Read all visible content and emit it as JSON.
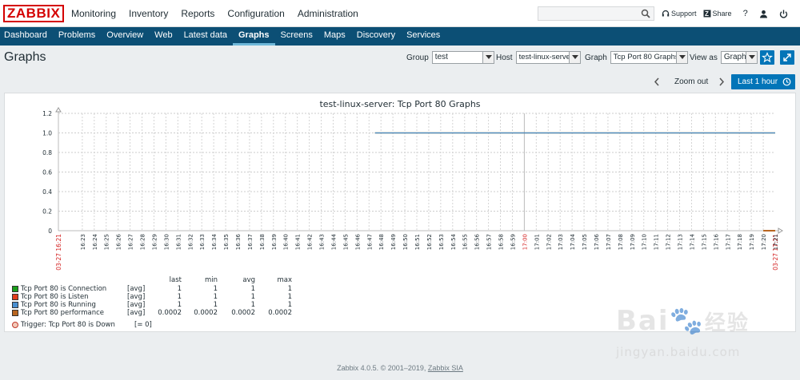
{
  "header": {
    "logo": "ZABBIX",
    "menu": [
      "Monitoring",
      "Inventory",
      "Reports",
      "Configuration",
      "Administration"
    ],
    "search_placeholder": "",
    "support_label": "Support",
    "share_label": "Share",
    "help_label": "?"
  },
  "submenu": [
    "Dashboard",
    "Problems",
    "Overview",
    "Web",
    "Latest data",
    "Graphs",
    "Screens",
    "Maps",
    "Discovery",
    "Services"
  ],
  "page": {
    "title": "Graphs",
    "group_label": "Group",
    "group_value": "test",
    "host_label": "Host",
    "host_value": "test-linux-server",
    "graph_label": "Graph",
    "graph_value": "Tcp Port 80 Graphs",
    "viewas_label": "View as",
    "viewas_value": "Graph"
  },
  "time": {
    "zoom_out": "Zoom out",
    "last_period": "Last 1 hour"
  },
  "chart_data": {
    "type": "line",
    "title": "test-linux-server: Tcp Port 80 Graphs",
    "y_ticks": [
      "1.2",
      "1.0",
      "0.8",
      "0.6",
      "0.4",
      "0.2",
      "0"
    ],
    "ylim": [
      0,
      1.2
    ],
    "x_start_label": "03-27 16:21",
    "x_end_label": "03-27 17:21",
    "x_ticks": [
      "16:23",
      "16:24",
      "16:25",
      "16:26",
      "16:27",
      "16:28",
      "16:29",
      "16:30",
      "16:31",
      "16:32",
      "16:33",
      "16:34",
      "16:35",
      "16:36",
      "16:37",
      "16:38",
      "16:39",
      "16:40",
      "16:41",
      "16:42",
      "16:43",
      "16:44",
      "16:45",
      "16:46",
      "16:47",
      "16:48",
      "16:49",
      "16:50",
      "16:51",
      "16:52",
      "16:53",
      "16:54",
      "16:55",
      "16:56",
      "16:57",
      "16:58",
      "16:59",
      "17:00",
      "17:01",
      "17:02",
      "17:03",
      "17:04",
      "17:05",
      "17:06",
      "17:07",
      "17:08",
      "17:09",
      "17:10",
      "17:11",
      "17:12",
      "17:13",
      "17:14",
      "17:15",
      "17:16",
      "17:17",
      "17:18",
      "17:19",
      "17:20",
      "17:21"
    ],
    "highlight_ticks": [
      "17:00"
    ],
    "grid": true,
    "series": [
      {
        "name": "Tcp Port 80 is Connection",
        "color": "#1a9e1a",
        "start": "16:47:30",
        "end": "17:21",
        "value": 1
      },
      {
        "name": "Tcp Port 80 is Listen",
        "color": "#e03c1a",
        "start": "16:47:30",
        "end": "17:21",
        "value": 1
      },
      {
        "name": "Tcp Port 80 is Running",
        "color": "#4a8fd0",
        "start": "16:47:30",
        "end": "17:21",
        "value": 1
      },
      {
        "name": "Tcp Port 80 performance",
        "color": "#b8651f",
        "start": "17:20",
        "end": "17:21",
        "value": 0.0002
      }
    ]
  },
  "legend": {
    "headers": [
      "last",
      "min",
      "avg",
      "max"
    ],
    "rows": [
      {
        "name": "Tcp Port 80 is Connection",
        "fn": "[avg]",
        "last": "1",
        "min": "1",
        "avg": "1",
        "max": "1",
        "color": "#1a9e1a"
      },
      {
        "name": "Tcp Port 80 is Listen",
        "fn": "[avg]",
        "last": "1",
        "min": "1",
        "avg": "1",
        "max": "1",
        "color": "#e03c1a"
      },
      {
        "name": "Tcp Port 80 is Running",
        "fn": "[avg]",
        "last": "1",
        "min": "1",
        "avg": "1",
        "max": "1",
        "color": "#4a8fd0"
      },
      {
        "name": "Tcp Port 80 performance",
        "fn": "[avg]",
        "last": "0.0002",
        "min": "0.0002",
        "avg": "0.0002",
        "max": "0.0002",
        "color": "#b8651f"
      }
    ],
    "trigger_name": "Trigger: Tcp Port 80 is Down",
    "trigger_value": "[= 0]"
  },
  "footer": {
    "text": "Zabbix 4.0.5. © 2001–2019, ",
    "link": "Zabbix SIA"
  },
  "watermark": {
    "brand": "Bai",
    "brand2": "经验",
    "url": "jingyan.baidu.com"
  }
}
